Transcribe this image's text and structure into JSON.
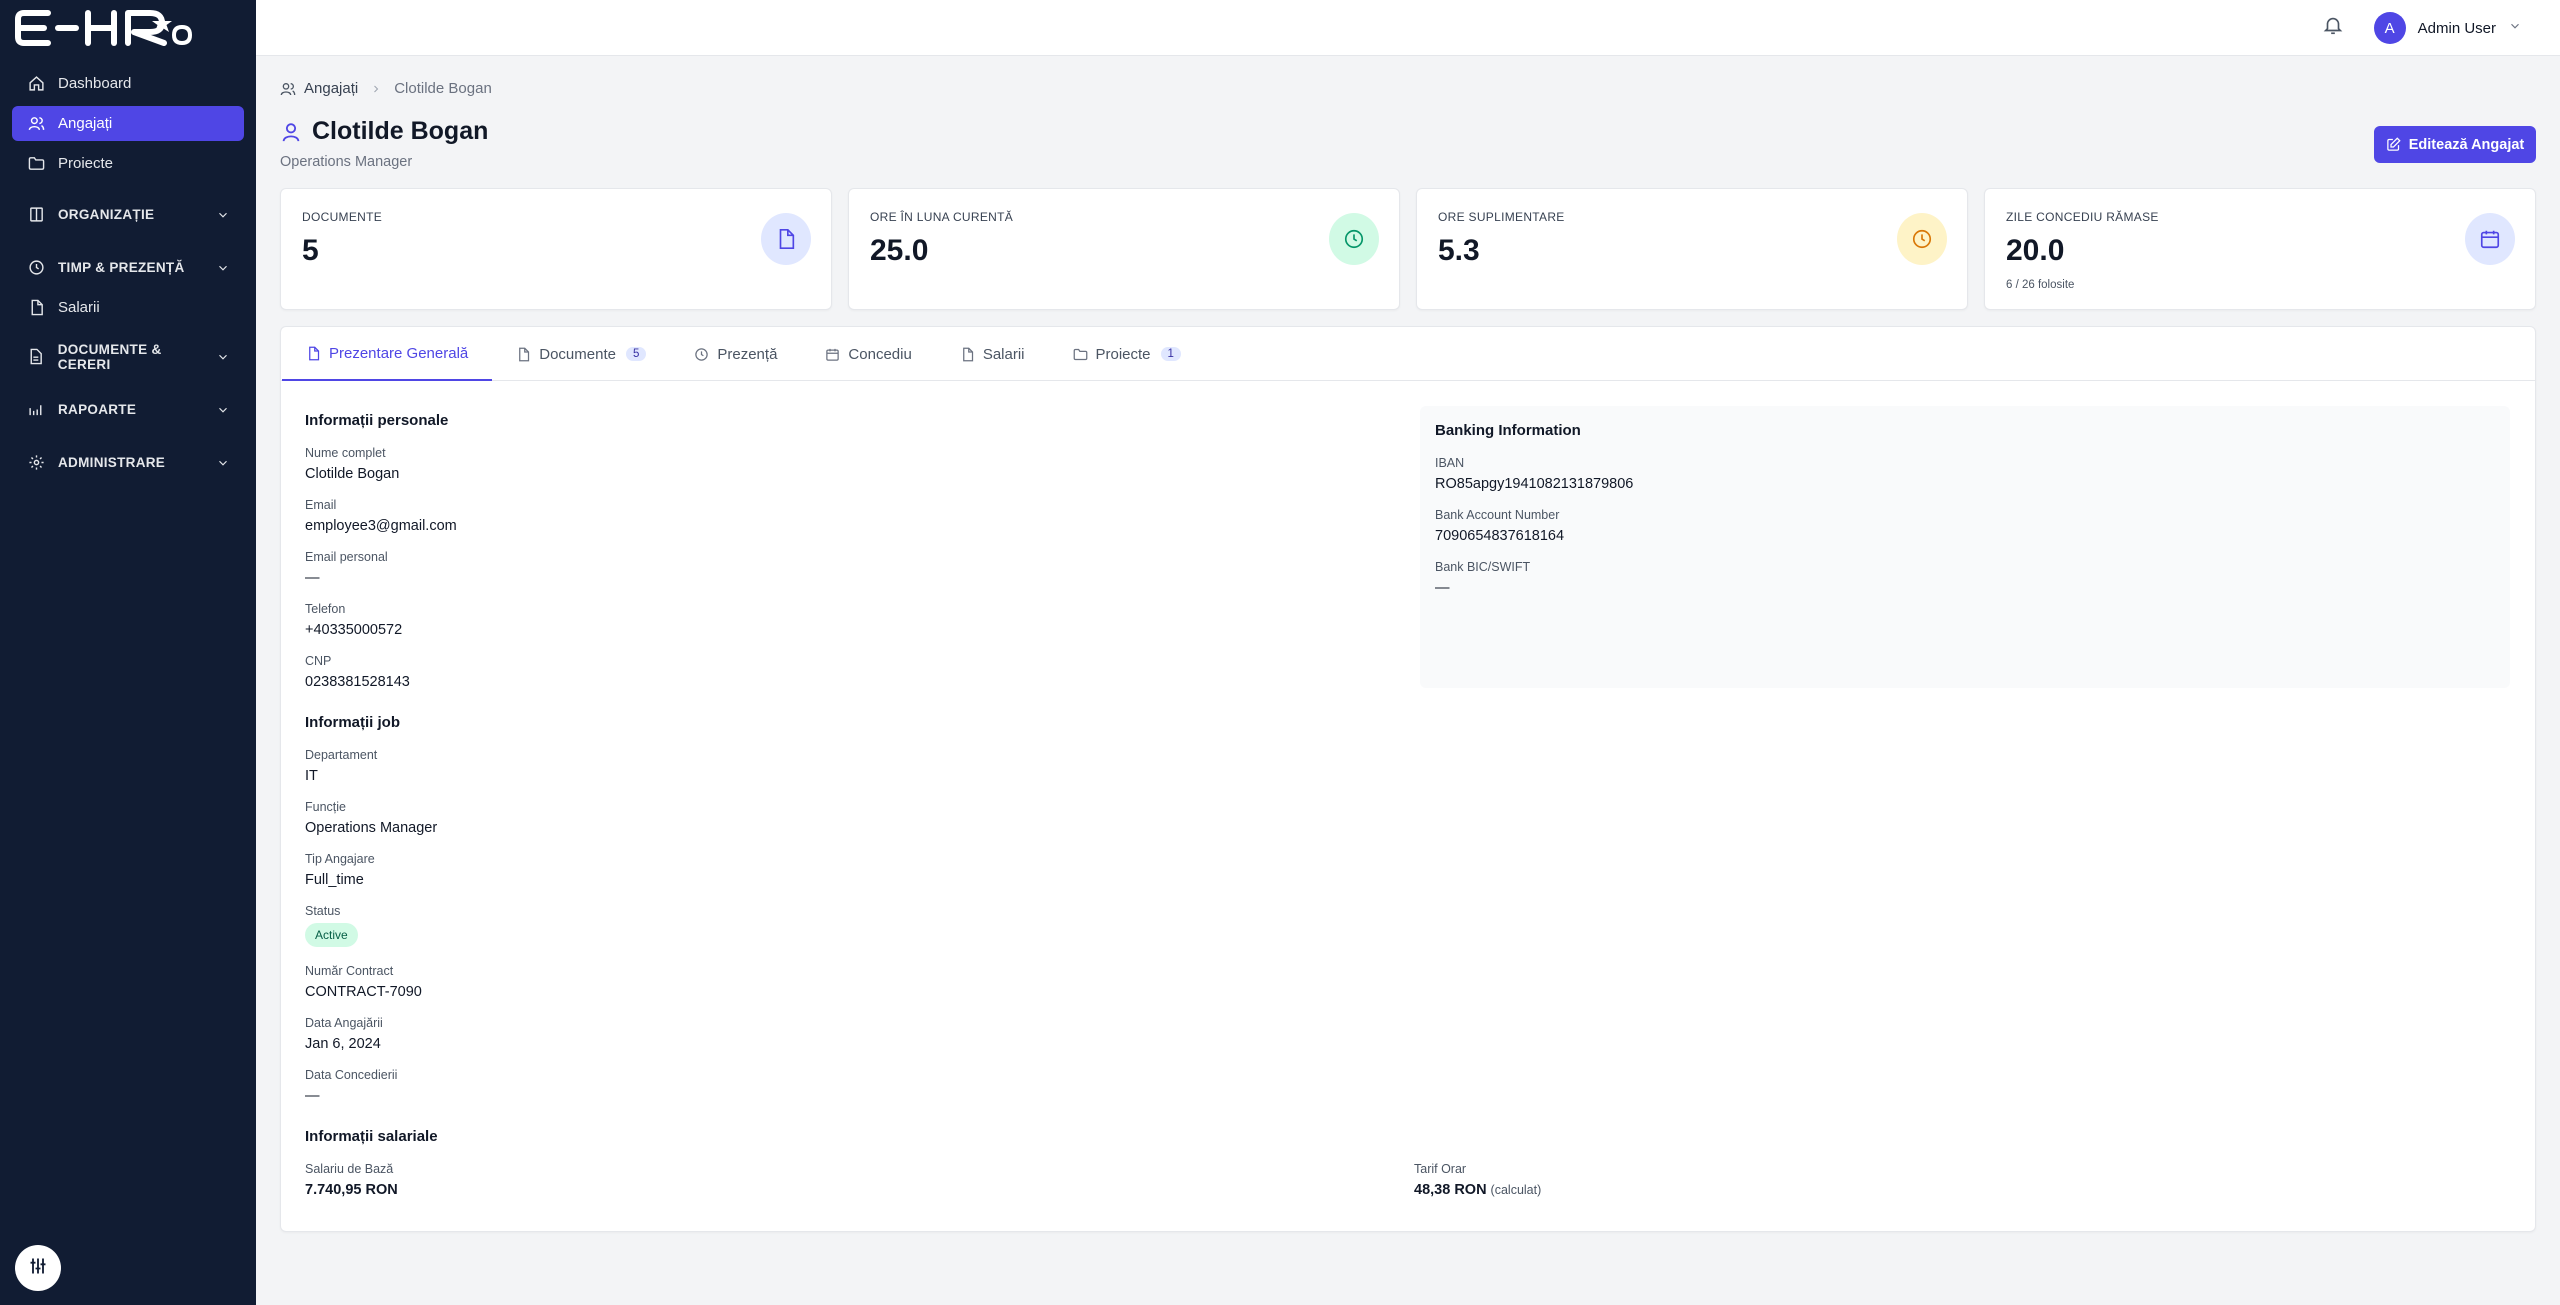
{
  "sidebar": {
    "logo": "E-HR",
    "items": [
      {
        "label": "Dashboard"
      },
      {
        "label": "Angajați"
      },
      {
        "label": "Proiecte"
      }
    ],
    "groups": [
      {
        "label": "ORGANIZAȚIE"
      },
      {
        "label": "TIMP & PREZENȚĂ"
      },
      {
        "label": "DOCUMENTE & CERERI"
      },
      {
        "label": "RAPOARTE"
      },
      {
        "label": "ADMINISTRARE"
      }
    ],
    "salarii": "Salarii"
  },
  "topbar": {
    "avatar_letter": "A",
    "user_name": "Admin User"
  },
  "breadcrumb": {
    "parent": "Angajați",
    "current": "Clotilde Bogan"
  },
  "header": {
    "title": "Clotilde Bogan",
    "subtitle": "Operations Manager",
    "edit_label": "Editează Angajat"
  },
  "stats": [
    {
      "label": "DOCUMENTE",
      "value": "5",
      "sub": ""
    },
    {
      "label": "ORE ÎN LUNA CURENTĂ",
      "value": "25.0",
      "sub": ""
    },
    {
      "label": "ORE SUPLIMENTARE",
      "value": "5.3",
      "sub": ""
    },
    {
      "label": "ZILE CONCEDIU RĂMASE",
      "value": "20.0",
      "sub": "6 / 26 folosite"
    }
  ],
  "tabs": [
    {
      "label": "Prezentare Generală"
    },
    {
      "label": "Documente",
      "count": "5"
    },
    {
      "label": "Prezență"
    },
    {
      "label": "Concediu"
    },
    {
      "label": "Salarii"
    },
    {
      "label": "Proiecte",
      "count": "1"
    }
  ],
  "personal": {
    "title": "Informații personale",
    "name_label": "Nume complet",
    "name": "Clotilde Bogan",
    "email_label": "Email",
    "email": "employee3@gmail.com",
    "personal_email_label": "Email personal",
    "personal_email": "—",
    "phone_label": "Telefon",
    "phone": "+40335000572",
    "cnp_label": "CNP",
    "cnp": "0238381528143"
  },
  "banking": {
    "title": "Banking Information",
    "iban_label": "IBAN",
    "iban": "RO85apgy1941082131879806",
    "account_label": "Bank Account Number",
    "account": "7090654837618164",
    "bic_label": "Bank BIC/SWIFT",
    "bic": "—"
  },
  "job": {
    "title": "Informații job",
    "department_label": "Departament",
    "department": "IT",
    "function_label": "Funcție",
    "function": "Operations Manager",
    "type_label": "Tip Angajare",
    "type": "Full_time",
    "status_label": "Status",
    "status": "Active",
    "contract_label": "Număr Contract",
    "contract": "CONTRACT-7090",
    "hire_label": "Data Angajării",
    "hire": "Jan 6, 2024",
    "leave_label": "Data Concedierii",
    "leave": "—"
  },
  "salary": {
    "title": "Informații salariale",
    "base_label": "Salariu de Bază",
    "base": "7.740,95 RON",
    "rate_label": "Tarif Orar",
    "rate": "48,38 RON",
    "rate_note": "(calculat)"
  },
  "colors": {
    "sidebar_bg": "#111c33",
    "accent": "#4f46e5",
    "active_status_bg": "#d1fae5"
  }
}
